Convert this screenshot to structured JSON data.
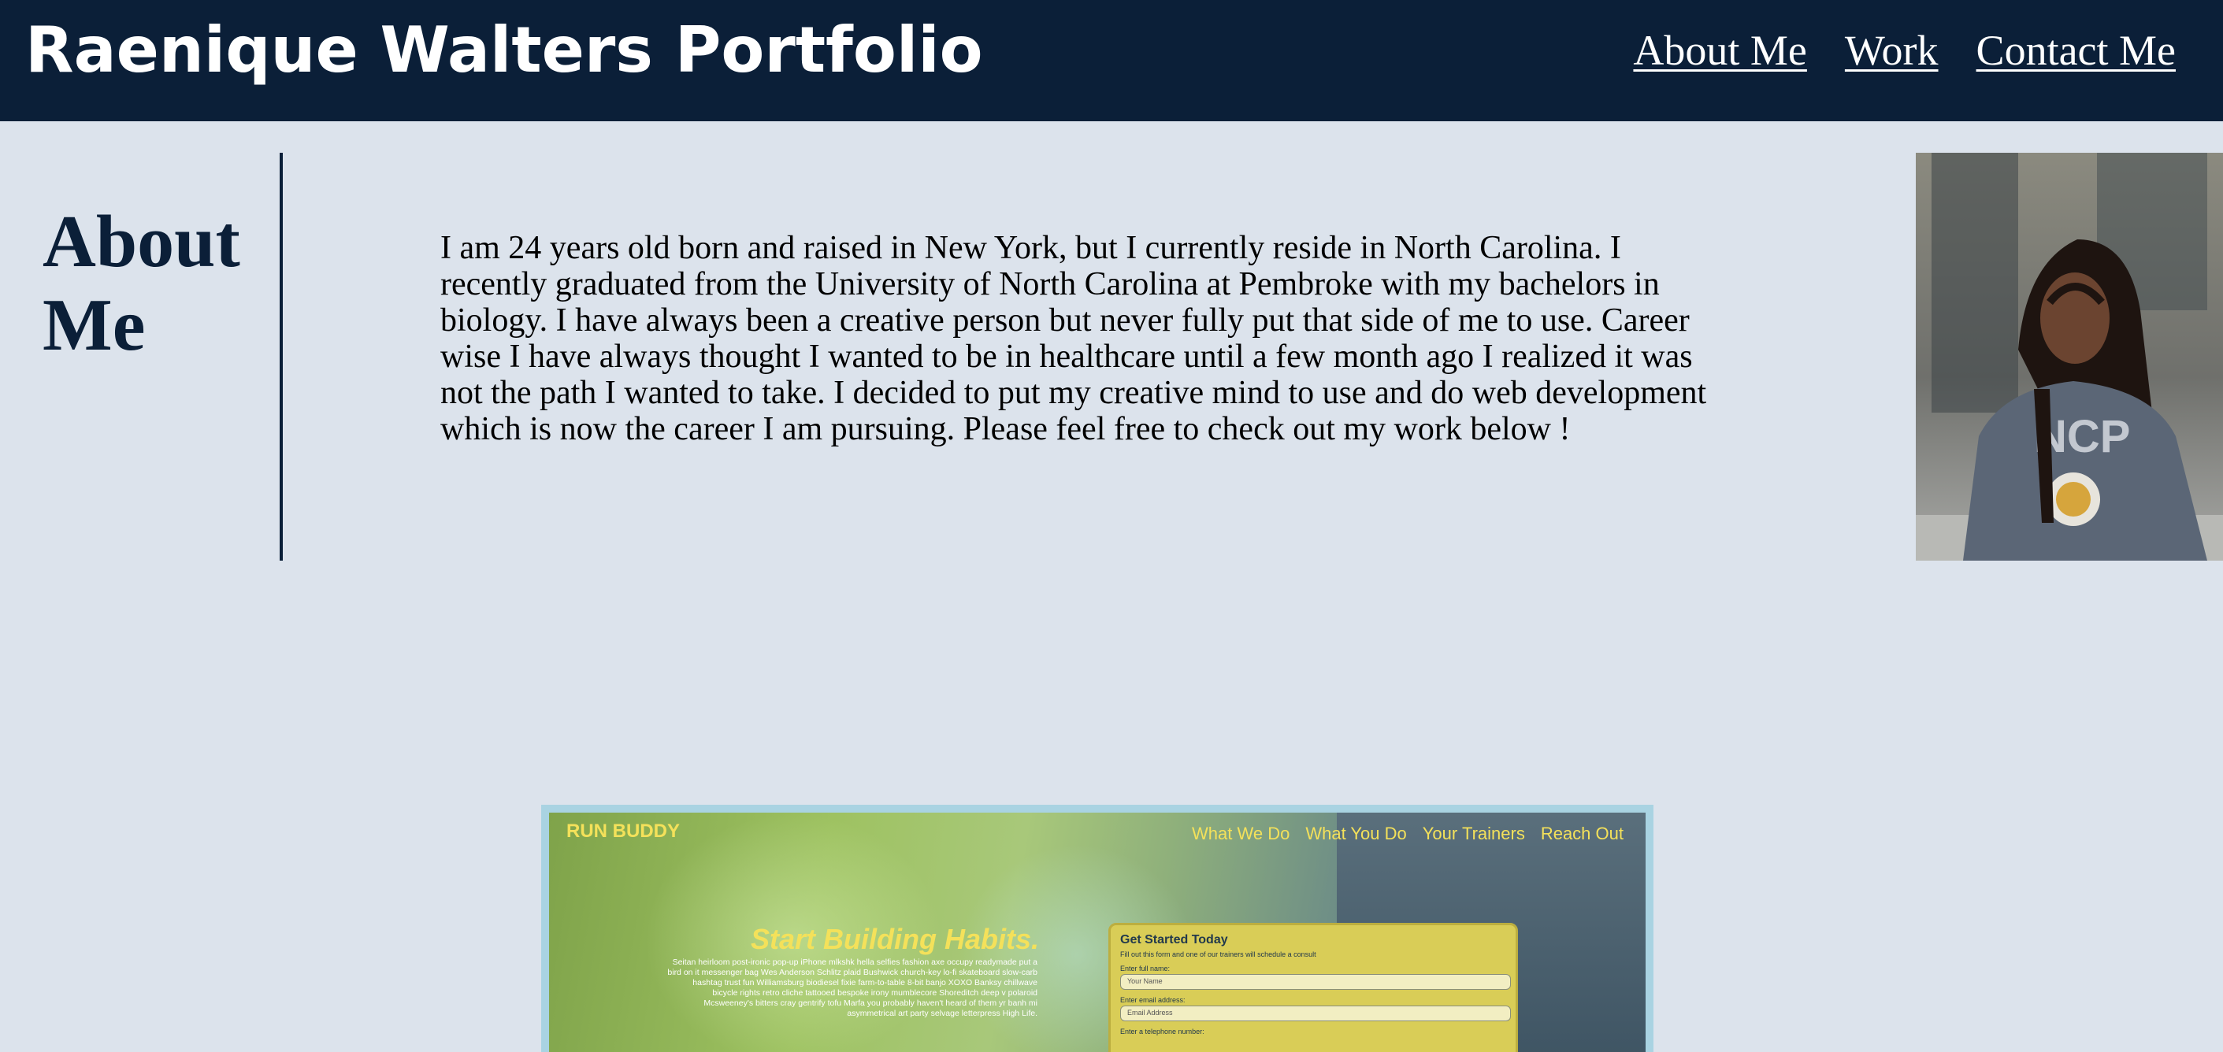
{
  "header": {
    "title": "Raenique Walters Portfolio",
    "nav": [
      "About Me",
      "Work",
      "Contact Me"
    ]
  },
  "about": {
    "heading_line1": "About",
    "heading_line2": "Me",
    "paragraph": "I am 24 years old born and raised in New York, but I currently reside in North Carolina. I recently graduated from the University of North Carolina at Pembroke with my bachelors in biology. I have always been a creative person but never fully put that side of me to use. Career wise I have always thought I wanted to be in healthcare until a few month ago I realized it was not the path I wanted to take. I decided to put my creative mind to use and do web development which is now the career I am pursuing. Please feel free to check out my work below !"
  },
  "project": {
    "brand": "RUN BUDDY",
    "nav": [
      "What We Do",
      "What You Do",
      "Your Trainers",
      "Reach Out"
    ],
    "headline": "Start Building Habits.",
    "body": "Seitan heirloom post-ironic pop-up iPhone mlkshk hella selfies fashion axe occupy readymade put a bird on it messenger bag Wes Anderson Schlitz plaid Bushwick church-key lo-fi skateboard slow-carb hashtag trust fun Williamsburg biodiesel fixie farm-to-table 8-bit banjo XOXO Banksy chillwave bicycle rights retro cliche tattooed bespoke irony mumblecore Shoreditch deep v polaroid Mcsweeney's bitters cray gentrify tofu Marfa you probably haven't heard of them yr banh mi asymmetrical art party selvage letterpress High Life.",
    "form": {
      "title": "Get Started Today",
      "subtitle": "Fill out this form and one of our trainers will schedule a consult",
      "name_label": "Enter full name:",
      "name_placeholder": "Your Name",
      "email_label": "Enter email address:",
      "email_placeholder": "Email Address",
      "phone_label": "Enter a telephone number:"
    }
  },
  "colors": {
    "header_bg": "#0b1f38",
    "page_bg": "#dce3ec",
    "accent_yellow": "#f4e15a"
  }
}
